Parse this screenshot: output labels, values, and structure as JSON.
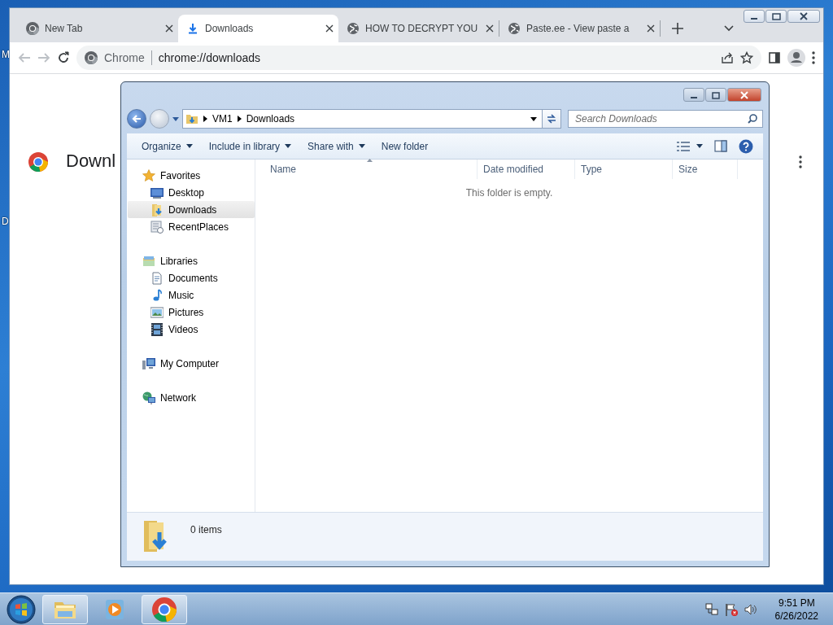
{
  "desktop": {
    "edge_labels": [
      "M",
      "D"
    ]
  },
  "browser": {
    "tabs": [
      {
        "title": "New Tab",
        "kind": "logo",
        "selected": false
      },
      {
        "title": "Downloads",
        "kind": "download",
        "selected": true
      },
      {
        "title": "HOW TO DECRYPT YOU",
        "kind": "globe",
        "selected": false
      },
      {
        "title": "Paste.ee - View paste a",
        "kind": "globe",
        "selected": false
      }
    ],
    "omnibox": {
      "chip": "Chrome",
      "url": "chrome://downloads"
    },
    "page_title": "Downl"
  },
  "explorer": {
    "breadcrumb": [
      "VM1",
      "Downloads"
    ],
    "search": {
      "placeholder": "Search Downloads"
    },
    "toolbar": [
      {
        "label": "Organize",
        "dropdown": true
      },
      {
        "label": "Include in library",
        "dropdown": true
      },
      {
        "label": "Share with",
        "dropdown": true
      },
      {
        "label": "New folder",
        "dropdown": false
      }
    ],
    "nav": [
      {
        "label": "Favorites",
        "kind": "star",
        "selected": false,
        "children": [
          {
            "label": "Desktop",
            "kind": "desktop",
            "selected": false
          },
          {
            "label": "Downloads",
            "kind": "downloads",
            "selected": true
          },
          {
            "label": "RecentPlaces",
            "kind": "recent",
            "selected": false
          }
        ]
      },
      {
        "label": "Libraries",
        "kind": "library",
        "selected": false,
        "children": [
          {
            "label": "Documents",
            "kind": "document",
            "selected": false
          },
          {
            "label": "Music",
            "kind": "music",
            "selected": false
          },
          {
            "label": "Pictures",
            "kind": "pictures",
            "selected": false
          },
          {
            "label": "Videos",
            "kind": "videos",
            "selected": false
          }
        ]
      },
      {
        "label": "My Computer",
        "kind": "computer",
        "selected": false
      },
      {
        "label": "Network",
        "kind": "network",
        "selected": false
      }
    ],
    "columns": [
      "Name",
      "Date modified",
      "Type",
      "Size"
    ],
    "empty_message": "This folder is empty.",
    "status": "0 items"
  },
  "taskbar": {
    "apps": [
      {
        "kind": "folder",
        "open": true
      },
      {
        "kind": "media",
        "open": false
      },
      {
        "kind": "browser",
        "open": true
      }
    ],
    "time": "9:51 PM",
    "date": "6/26/2022"
  }
}
